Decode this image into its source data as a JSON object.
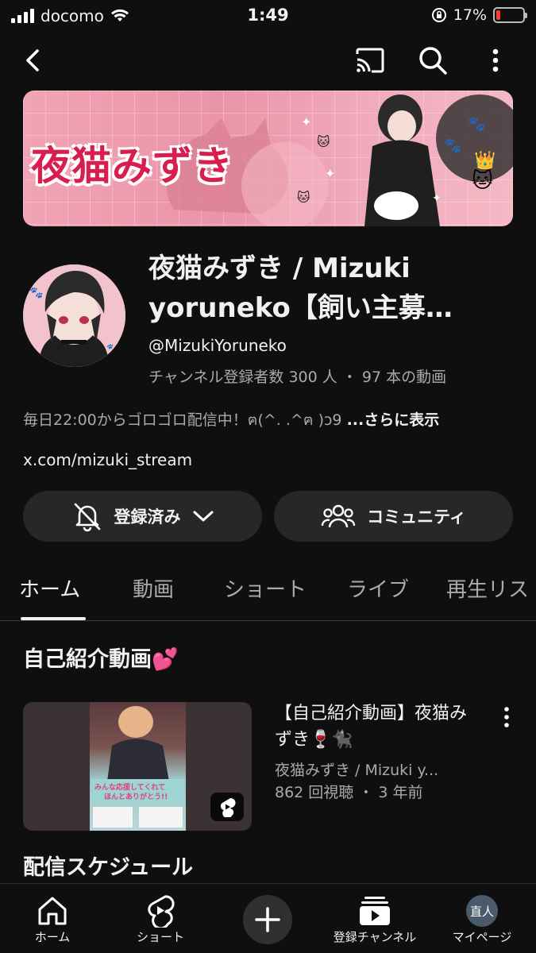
{
  "status_bar": {
    "carrier": "docomo",
    "time": "1:49",
    "battery_text": "17%",
    "battery_level": 0.17
  },
  "appbar": {
    "icons": [
      "back-icon",
      "cast-icon",
      "search-icon",
      "more-vert-icon"
    ]
  },
  "banner": {
    "text": "夜猫みずき"
  },
  "channel": {
    "title_line1": "夜猫みずき / Mizuki",
    "title_line2": "yoruneko【飼い主募…",
    "handle": "@MizukiYoruneko",
    "stats": "チャンネル登録者数 300 人 ・ 97 本の動画",
    "description": "毎日22:00からゴロゴロ配信中！ฅ(^. .^ฅ )ɔ9 ",
    "description_more": "...さらに表示",
    "link": "x.com/mizuki_stream"
  },
  "actions": {
    "subscribed_label": "登録済み",
    "community_label": "コミュニティ"
  },
  "tabs": [
    {
      "label": "ホーム",
      "active": true
    },
    {
      "label": "動画",
      "active": false
    },
    {
      "label": "ショート",
      "active": false
    },
    {
      "label": "ライブ",
      "active": false
    },
    {
      "label": "再生リス",
      "active": false
    }
  ],
  "sections": {
    "intro_title": "自己紹介動画💕",
    "schedule_title": "配信スケジュール"
  },
  "video": {
    "title": "【自己紹介動画】夜猫みずき🍷🐈‍⬛",
    "channel": "夜猫みずき / Mizuki y...",
    "meta": "862 回視聴 ・ 3 年前"
  },
  "bottom_nav": {
    "home": "ホーム",
    "shorts": "ショート",
    "subscriptions": "登録チャンネル",
    "you": "マイページ",
    "avatar_text": "直人"
  },
  "colors": {
    "background": "#0f0f0f",
    "surface": "#272727",
    "text_primary": "#f1f1f1",
    "text_secondary": "#aaaaaa",
    "banner_pink": "#ea94a8",
    "banner_text": "#d81e4e"
  }
}
